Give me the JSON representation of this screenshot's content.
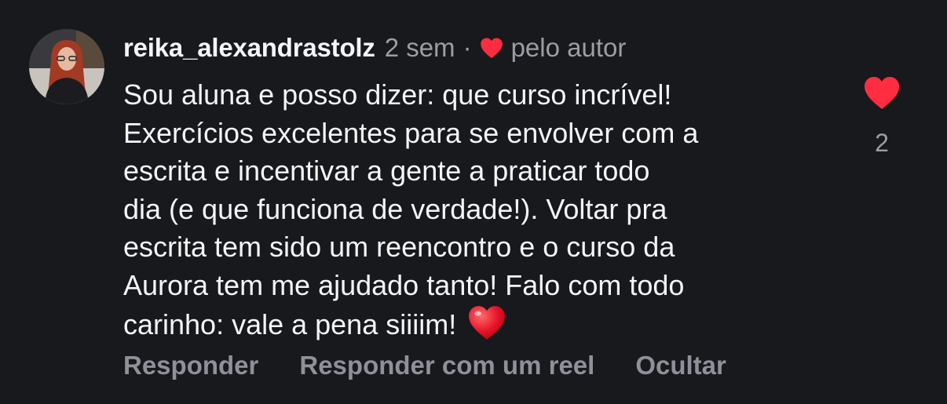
{
  "comment": {
    "username": "reika_alexandrastolz",
    "time": "2 sem",
    "separator": "·",
    "liked_by_author_label": "pelo autor",
    "body_lines": [
      "Sou aluna e posso dizer: que curso incrível!",
      "Exercícios excelentes para se envolver com a",
      "escrita e incentivar a gente a praticar todo",
      "dia (e que funciona de verdade!). Voltar pra",
      "escrita tem sido um reencontro e o curso da",
      "Aurora tem me ajudado tanto! Falo com todo",
      "carinho: vale a pena siiiim!"
    ],
    "like_count": "2",
    "liked": true
  },
  "actions": {
    "reply": "Responder",
    "reply_reel": "Responder com um reel",
    "hide": "Ocultar"
  },
  "colors": {
    "background": "#17191c",
    "text": "#f4f5f7",
    "muted": "#9b9ea5",
    "heart": "#ff2d3f"
  },
  "icons": {
    "avatar": "profile-photo",
    "author_like": "heart-icon",
    "like_button": "heart-icon",
    "emoji": "red-heart-emoji"
  }
}
